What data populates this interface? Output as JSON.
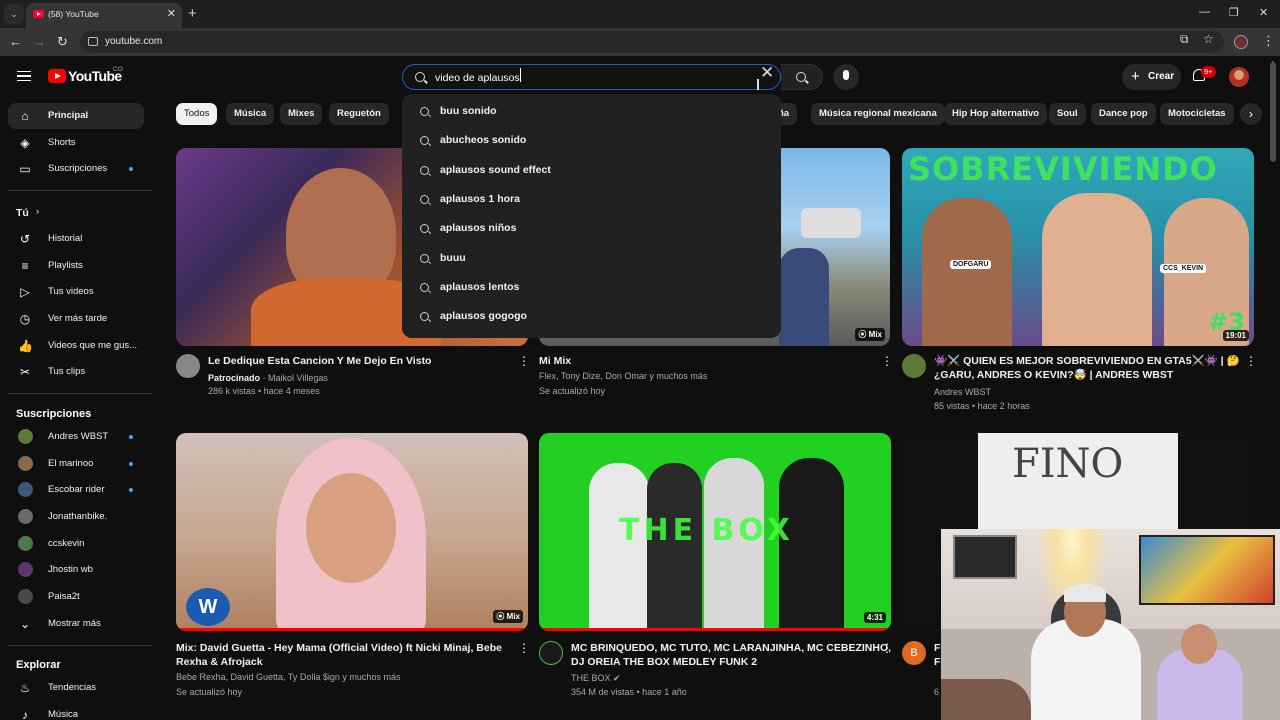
{
  "browser": {
    "tab_title": "(58) YouTube",
    "url": "youtube.com"
  },
  "header": {
    "logo": "YouTube",
    "country": "CO",
    "search_value": "video de aplausos",
    "create_label": "Crear",
    "notifications_badge": "9+"
  },
  "suggestions": [
    "buu sonido",
    "abucheos sonido",
    "aplausos sound effect",
    "aplausos 1 hora",
    "aplausos niños",
    "buuu",
    "aplausos lentos",
    "aplausos gogogo"
  ],
  "sidebar": {
    "main": [
      {
        "label": "Principal",
        "icon": "home-icon"
      },
      {
        "label": "Shorts",
        "icon": "shorts-icon"
      },
      {
        "label": "Suscripciones",
        "icon": "subscriptions-icon"
      }
    ],
    "you_label": "Tú",
    "you_items": [
      {
        "label": "Historial",
        "icon": "history-icon"
      },
      {
        "label": "Playlists",
        "icon": "playlists-icon"
      },
      {
        "label": "Tus videos",
        "icon": "your-videos-icon"
      },
      {
        "label": "Ver más tarde",
        "icon": "watch-later-icon"
      },
      {
        "label": "Videos que me gus...",
        "icon": "liked-icon"
      },
      {
        "label": "Tus clips",
        "icon": "clips-icon"
      }
    ],
    "subs_heading": "Suscripciones",
    "subs": [
      {
        "label": "Andres WBST",
        "color": "#5a7a3a",
        "dot": true
      },
      {
        "label": "El marinoo",
        "color": "#8a6a4a",
        "dot": true
      },
      {
        "label": "Escobar rider",
        "color": "#3a5a7a",
        "dot": true
      },
      {
        "label": "Jonathanbike.",
        "color": "#6a6a6a",
        "dot": false
      },
      {
        "label": "ccskevin",
        "color": "#4a7a4a",
        "dot": false
      },
      {
        "label": "Jhostin wb",
        "color": "#5a3a6a",
        "dot": false
      },
      {
        "label": "Paisa2t",
        "color": "#4a4a4a",
        "dot": false
      }
    ],
    "show_more": "Mostrar más",
    "explore_heading": "Explorar",
    "explore": [
      {
        "label": "Tendencias",
        "icon": "trending-icon"
      },
      {
        "label": "Música",
        "icon": "music-icon"
      }
    ]
  },
  "chips": [
    "Todos",
    "Música",
    "Mixes",
    "Reguetón",
    "ña",
    "Música regional mexicana",
    "Hip Hop alternativo",
    "Soul",
    "Dance pop",
    "Motocicletas"
  ],
  "videos": [
    {
      "title": "Le Dedique Esta Cancion Y Me Dejo En Visto",
      "sponsored": "Patrocinado",
      "channel": "Maikol Villegas",
      "meta": "286 k vistas • hace 4 meses"
    },
    {
      "title": "Mi Mix",
      "channel": "Flex, Tony Dize, Don Omar y muchos más",
      "meta": "Se actualizó hoy",
      "badge": "Mix"
    },
    {
      "title_line1": "👾⚔️ QUIEN ES MEJOR SOBREVIVIENDO EN GTA5⚔️👾 | 🤔",
      "title_line2": "¿GARU, ANDRES O KEVIN?🤯 | ANDRES WBST",
      "channel": "Andres WBST",
      "meta": "85 vistas • hace 2 horas",
      "duration": "19:01",
      "thumb_text": "SOBREVIVIENDO",
      "tag_left": "DOFGARU",
      "tag_right": "CCS_KEVIN",
      "number_text": "#3"
    },
    {
      "title_line1": "Mix: David Guetta - Hey Mama (Official Video) ft Nicki Minaj, Bebe",
      "title_line2": "Rexha & Afrojack",
      "channel": "Bebe Rexha, David Guetta, Ty Dolla $ign y muchos más",
      "meta": "Se actualizó hoy",
      "badge": "Mix"
    },
    {
      "title_line1": "MC BRINQUEDO, MC TUTO, MC LARANJINHA, MC CEBEZINHO,",
      "title_line2": "DJ OREIA THE BOX MEDLEY FUNK 2",
      "channel": "THE BOX",
      "meta": "354 M de vistas • hace 1 año",
      "duration": "4:31",
      "thumb_text": "THE BOX"
    },
    {
      "title": "F",
      "title_line2": "F",
      "thumb_text": "FINO",
      "avatar_letter": "B",
      "meta": "6"
    }
  ]
}
